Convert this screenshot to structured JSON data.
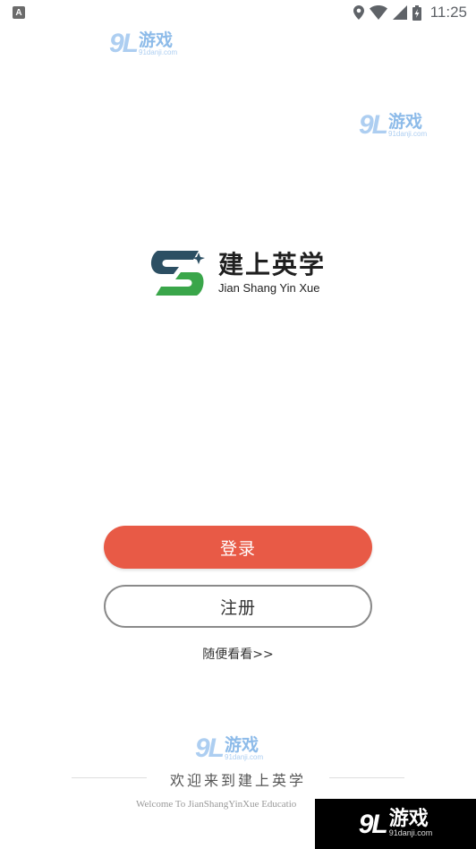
{
  "status_bar": {
    "app_badge": "A",
    "time": "11:25",
    "icons": [
      "location-icon",
      "wifi-icon",
      "cellular-signal-icon",
      "battery-charging-icon"
    ]
  },
  "watermarks": {
    "number": "9L",
    "brand": "游戏",
    "domain": "91danji.com"
  },
  "logo": {
    "title_zh": "建上英学",
    "title_en": "Jian Shang Yin Xue",
    "colors": {
      "dark": "#2c4f63",
      "green": "#3aa64a"
    }
  },
  "actions": {
    "login_label": "登录",
    "register_label": "注册",
    "browse_label": "随便看看>>",
    "login_color": "#e85a46"
  },
  "footer": {
    "welcome_zh": "欢迎来到建上英学",
    "welcome_en": "Welcome To JianShangYinXue Educatio"
  }
}
